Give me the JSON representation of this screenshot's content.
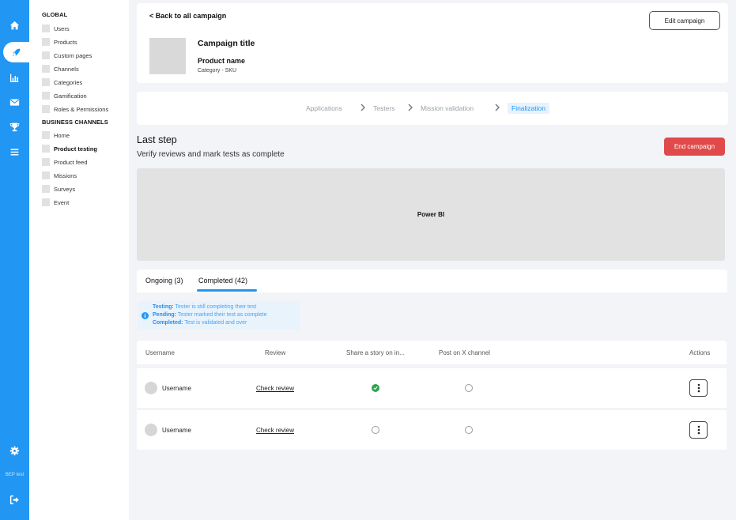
{
  "rail": {
    "items": [
      {
        "icon": "home-icon"
      },
      {
        "icon": "rocket-icon",
        "active": true
      },
      {
        "icon": "chart-icon"
      },
      {
        "icon": "mail-icon"
      },
      {
        "icon": "trophy-icon"
      },
      {
        "icon": "list-icon"
      }
    ],
    "settings_icon": "gear-icon",
    "user_label": "BEP test",
    "logout_icon": "logout-icon",
    "color": "#2196f3"
  },
  "subnav": {
    "global_heading": "GLOBAL",
    "global_items": [
      "Users",
      "Products",
      "Custom pages",
      "Channels",
      "Categories",
      "Gamification",
      "Roles & Permissions"
    ],
    "business_heading": "BUSINESS CHANNELS",
    "business_items": [
      "Home",
      "Product testing",
      "Product feed",
      "Missions",
      "Surveys",
      "Event"
    ],
    "active_item": "Product testing"
  },
  "header": {
    "back_label": "< Back to all campaign",
    "edit_label": "Edit campaign",
    "campaign_title": "Campaign title",
    "product_name": "Product name",
    "product_category": "Category - SKU"
  },
  "stepper": {
    "steps": [
      "Applications",
      "Testers",
      "Mission validation",
      "Finalization"
    ],
    "current": "Finalization"
  },
  "section": {
    "title": "Last step",
    "subtitle": "Verify reviews and mark tests as complete",
    "end_label": "End campaign",
    "end_color": "#e04a4a"
  },
  "embed": {
    "label": "Power BI"
  },
  "tabs": [
    {
      "label": "Ongoing (3)",
      "active": false
    },
    {
      "label": "Completed (42)",
      "active": true
    }
  ],
  "legend": {
    "items": [
      {
        "term": "Testing:",
        "desc": " Tester is still completing their test"
      },
      {
        "term": "Pending:",
        "desc": " Tester marked their test as complete"
      },
      {
        "term": "Completed:",
        "desc": " Test is validated and over"
      }
    ]
  },
  "table": {
    "columns": [
      "Username",
      "Review",
      "Share a story on in...",
      "Post on X channel",
      "Actions"
    ],
    "rows": [
      {
        "username": "Username",
        "review": "Check review",
        "story_done": true,
        "x_post_done": false
      },
      {
        "username": "Username",
        "review": "Check review",
        "story_done": false,
        "x_post_done": false
      }
    ]
  }
}
